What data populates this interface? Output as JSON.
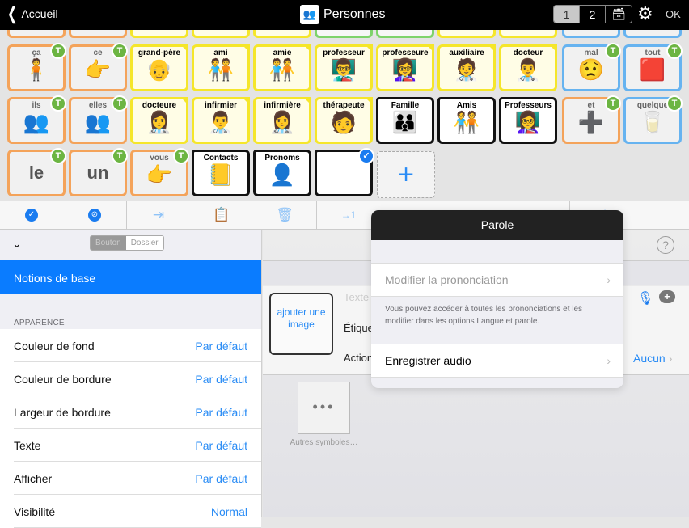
{
  "topbar": {
    "back_label": "Accueil",
    "title": "Personnes",
    "pages": [
      "1",
      "2"
    ],
    "active_page": "1",
    "ok_label": "OK"
  },
  "grid": {
    "partial_top_row": [
      "",
      "",
      "",
      "",
      "",
      "",
      "",
      "",
      "",
      "",
      ""
    ],
    "row1": [
      {
        "label": "ça",
        "type": "word",
        "border": "orange",
        "pic": "🧍"
      },
      {
        "label": "ce",
        "type": "word",
        "border": "orange",
        "pic": "👉"
      },
      {
        "label": "grand-père",
        "type": "noun",
        "border": "yellow",
        "pic": "👴"
      },
      {
        "label": "ami",
        "type": "noun",
        "border": "yellow",
        "pic": "🧑‍🤝‍🧑"
      },
      {
        "label": "amie",
        "type": "noun",
        "border": "yellow",
        "pic": "🧑‍🤝‍🧑"
      },
      {
        "label": "professeur",
        "type": "noun",
        "border": "yellow",
        "pic": "👨‍🏫"
      },
      {
        "label": "professeure",
        "type": "noun",
        "border": "yellow",
        "pic": "👩‍🏫"
      },
      {
        "label": "auxiliaire",
        "type": "noun",
        "border": "yellow",
        "pic": "🧑‍⚕️"
      },
      {
        "label": "docteur",
        "type": "noun",
        "border": "yellow",
        "pic": "👨‍⚕️"
      },
      {
        "label": "mal",
        "type": "word",
        "border": "blue",
        "pic": "😟"
      },
      {
        "label": "tout",
        "type": "word",
        "border": "blue",
        "pic": "🟥"
      }
    ],
    "row2": [
      {
        "label": "ils",
        "type": "word",
        "border": "orange",
        "pic": "👥"
      },
      {
        "label": "elles",
        "type": "word",
        "border": "orange",
        "pic": "👥"
      },
      {
        "label": "docteure",
        "type": "noun",
        "border": "yellow",
        "pic": "👩‍⚕️"
      },
      {
        "label": "infirmier",
        "type": "noun",
        "border": "yellow",
        "pic": "👨‍⚕️"
      },
      {
        "label": "infirmière",
        "type": "noun",
        "border": "yellow",
        "pic": "👩‍⚕️"
      },
      {
        "label": "thérapeute",
        "type": "noun",
        "border": "yellow",
        "pic": "🧑"
      },
      {
        "label": "Famille",
        "type": "folder",
        "pic": "👪"
      },
      {
        "label": "Amis",
        "type": "folder",
        "pic": "🧑‍🤝‍🧑"
      },
      {
        "label": "Professeurs",
        "type": "folder",
        "pic": "👩‍🏫"
      },
      {
        "label": "et",
        "type": "word",
        "border": "orange",
        "pic": "➕"
      },
      {
        "label": "quelque",
        "type": "word",
        "border": "blue",
        "pic": "🥛"
      }
    ],
    "row3": [
      {
        "label": "le",
        "type": "bigword",
        "border": "orange"
      },
      {
        "label": "un",
        "type": "bigword",
        "border": "orange"
      },
      {
        "label": "vous",
        "type": "word",
        "border": "orange",
        "pic": "👉"
      },
      {
        "label": "Contacts",
        "type": "folder",
        "pic": "📒"
      },
      {
        "label": "Pronoms",
        "type": "folder",
        "pic": "👤"
      },
      {
        "label": "",
        "type": "folder-selected"
      }
    ],
    "add_label": "+"
  },
  "toolbar": {
    "icons": [
      "select-all",
      "deselect",
      "import",
      "paste",
      "delete",
      "move-to-page",
      "",
      "",
      "",
      "swap"
    ]
  },
  "left_panel": {
    "segment": {
      "options": [
        "Bouton",
        "Dossier"
      ],
      "selected": "Bouton"
    },
    "selected_item": "Notions de base",
    "section_header": "APPARENCE",
    "rows": [
      {
        "label": "Couleur de fond",
        "value": "Par défaut"
      },
      {
        "label": "Couleur de bordure",
        "value": "Par défaut"
      },
      {
        "label": "Largeur de bordure",
        "value": "Par défaut"
      },
      {
        "label": "Texte",
        "value": "Par défaut"
      },
      {
        "label": "Afficher",
        "value": "Par défaut"
      },
      {
        "label": "Visibilité",
        "value": "Normal"
      }
    ]
  },
  "right_panel": {
    "add_image_label": "ajouter une image",
    "text_placeholder": "Texte",
    "label_field": "Étiquette",
    "action_field": "Action",
    "action_value": "Aucun",
    "more_symbols_label": "Autres symboles…"
  },
  "popover": {
    "title": "Parole",
    "modify_pronunciation": "Modifier la prononciation",
    "note": "Vous pouvez accéder à toutes les prononciations et les modifier dans les options Langue et parole.",
    "record_audio": "Enregistrer audio"
  }
}
